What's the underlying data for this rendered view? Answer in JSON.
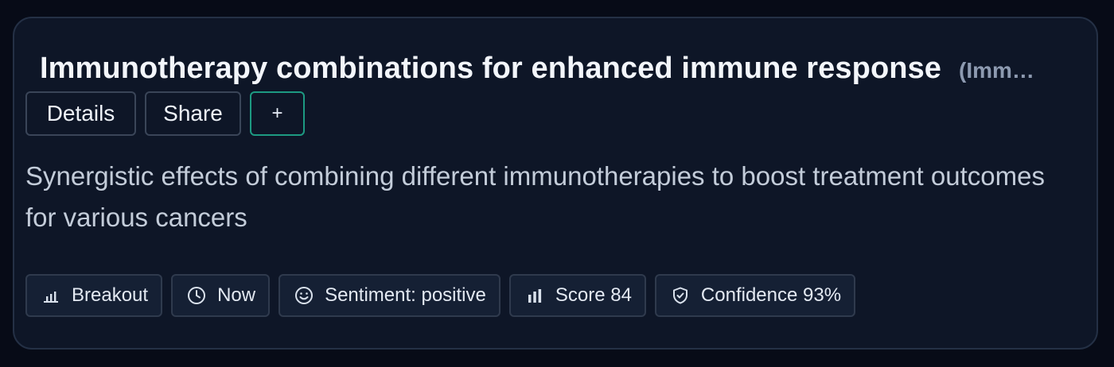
{
  "card": {
    "title": "Immunotherapy combinations for enhanced immune response",
    "title_suffix": "(Imm…",
    "actions": {
      "details_label": "Details",
      "share_label": "Share",
      "add_label": "+"
    },
    "description": "Synergistic effects of combining different immunotherapies to boost treatment outcomes for various cancers",
    "tags": [
      {
        "icon": "bar-chart-icon",
        "label": "Breakout"
      },
      {
        "icon": "clock-icon",
        "label": "Now"
      },
      {
        "icon": "smiley-icon",
        "label": "Sentiment: positive"
      },
      {
        "icon": "bar-chart-icon",
        "label": "Score 84"
      },
      {
        "icon": "shield-check-icon",
        "label": "Confidence 93%"
      }
    ]
  },
  "colors": {
    "background": "#070b17",
    "card": "#0e1627",
    "accent": "#1d9a82"
  }
}
